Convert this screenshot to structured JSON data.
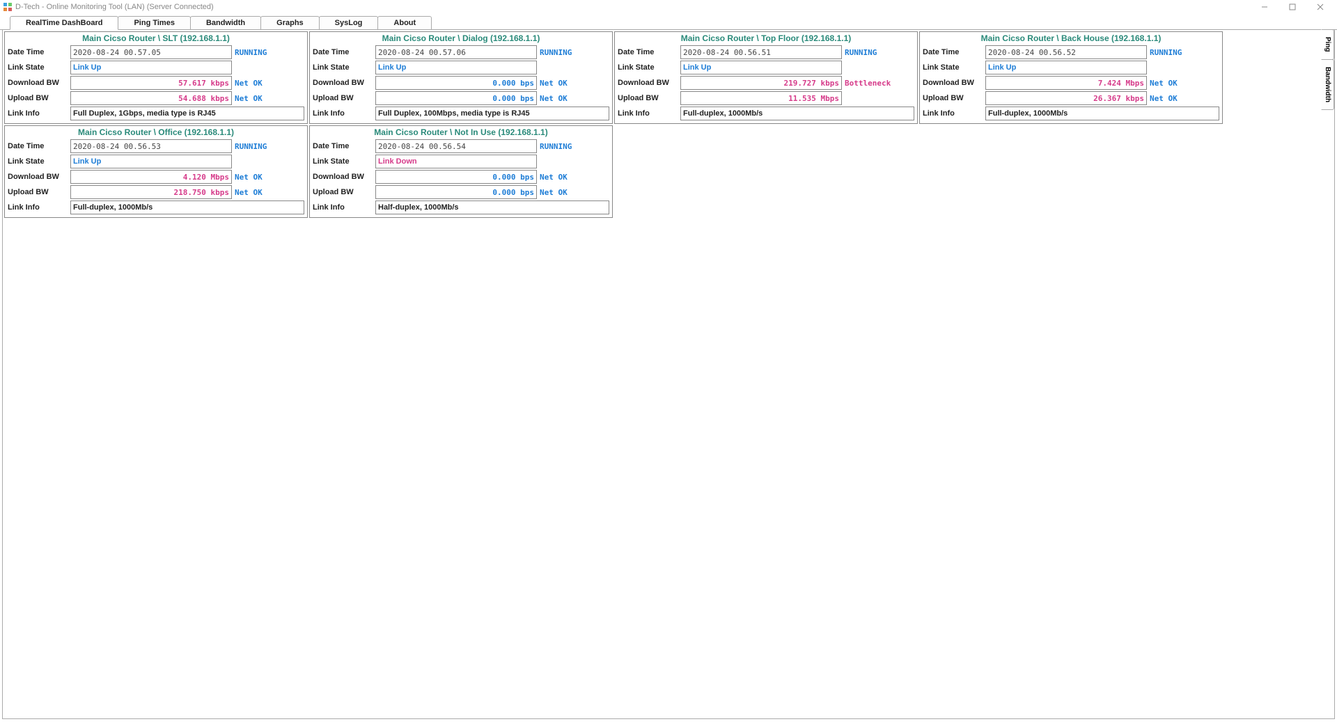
{
  "window": {
    "title": "D-Tech - Online Monitoring Tool (LAN) (Server Connected)"
  },
  "tabs": {
    "realtime": "RealTime DashBoard",
    "ping": "Ping Times",
    "bandwidth": "Bandwidth",
    "graphs": "Graphs",
    "syslog": "SysLog",
    "about": "About"
  },
  "sidetabs": {
    "ping": "Ping",
    "bandwidth": "Bandwidth"
  },
  "labels": {
    "datetime": "Date Time",
    "linkstate": "Link State",
    "downloadbw": "Download BW",
    "uploadbw": "Upload BW",
    "linkinfo": "Link Info"
  },
  "colors": {
    "bw_pink": "#d63b8a",
    "bw_blue": "#1e7dd6"
  },
  "panels": [
    {
      "title": "Main Cicso Router \\ SLT (192.168.1.1)",
      "datetime": "2020-08-24 00.57.05",
      "run": "RUNNING",
      "linkstate": "Link Up",
      "linkdown": false,
      "dlbw": "57.617 kbps",
      "dlcolor": "bw_pink",
      "dlstatus": "Net OK",
      "dlstat_class": "netok",
      "ulbw": "54.688 kbps",
      "ulcolor": "bw_pink",
      "ulstatus": "Net OK",
      "ulstat_class": "netok",
      "linkinfo": "Full Duplex, 1Gbps, media type is RJ45"
    },
    {
      "title": "Main Cicso Router \\ Dialog (192.168.1.1)",
      "datetime": "2020-08-24 00.57.06",
      "run": "RUNNING",
      "linkstate": "Link Up",
      "linkdown": false,
      "dlbw": "0.000 bps",
      "dlcolor": "bw_blue",
      "dlstatus": "Net OK",
      "dlstat_class": "netok",
      "ulbw": "0.000 bps",
      "ulcolor": "bw_blue",
      "ulstatus": "Net OK",
      "ulstat_class": "netok",
      "linkinfo": "Full Duplex, 100Mbps, media type is RJ45"
    },
    {
      "title": "Main Cicso Router \\ Top Floor  (192.168.1.1)",
      "datetime": "2020-08-24 00.56.51",
      "run": "RUNNING",
      "linkstate": "Link Up",
      "linkdown": false,
      "dlbw": "219.727 kbps",
      "dlcolor": "bw_pink",
      "dlstatus": "Bottleneck",
      "dlstat_class": "bottleneck",
      "ulbw": "11.535 Mbps",
      "ulcolor": "bw_pink",
      "ulstatus": "",
      "ulstat_class": "netok",
      "linkinfo": "Full-duplex, 1000Mb/s"
    },
    {
      "title": "Main Cicso Router \\ Back House  (192.168.1.1)",
      "datetime": "2020-08-24 00.56.52",
      "run": "RUNNING",
      "linkstate": "Link Up",
      "linkdown": false,
      "dlbw": "7.424 Mbps",
      "dlcolor": "bw_pink",
      "dlstatus": "Net OK",
      "dlstat_class": "netok",
      "ulbw": "26.367 kbps",
      "ulcolor": "bw_pink",
      "ulstatus": "Net OK",
      "ulstat_class": "netok",
      "linkinfo": "Full-duplex, 1000Mb/s"
    },
    {
      "title": "Main Cicso Router \\ Office (192.168.1.1)",
      "datetime": "2020-08-24 00.56.53",
      "run": "RUNNING",
      "linkstate": "Link Up",
      "linkdown": false,
      "dlbw": "4.120 Mbps",
      "dlcolor": "bw_pink",
      "dlstatus": "Net OK",
      "dlstat_class": "netok",
      "ulbw": "218.750 kbps",
      "ulcolor": "bw_pink",
      "ulstatus": "Net OK",
      "ulstat_class": "netok",
      "linkinfo": "Full-duplex, 1000Mb/s"
    },
    {
      "title": "Main Cicso Router \\ Not In Use (192.168.1.1)",
      "datetime": "2020-08-24 00.56.54",
      "run": "RUNNING",
      "linkstate": "Link Down",
      "linkdown": true,
      "dlbw": "0.000 bps",
      "dlcolor": "bw_blue",
      "dlstatus": "Net OK",
      "dlstat_class": "netok",
      "ulbw": "0.000 bps",
      "ulcolor": "bw_blue",
      "ulstatus": "Net OK",
      "ulstat_class": "netok",
      "linkinfo": "Half-duplex, 1000Mb/s"
    }
  ]
}
